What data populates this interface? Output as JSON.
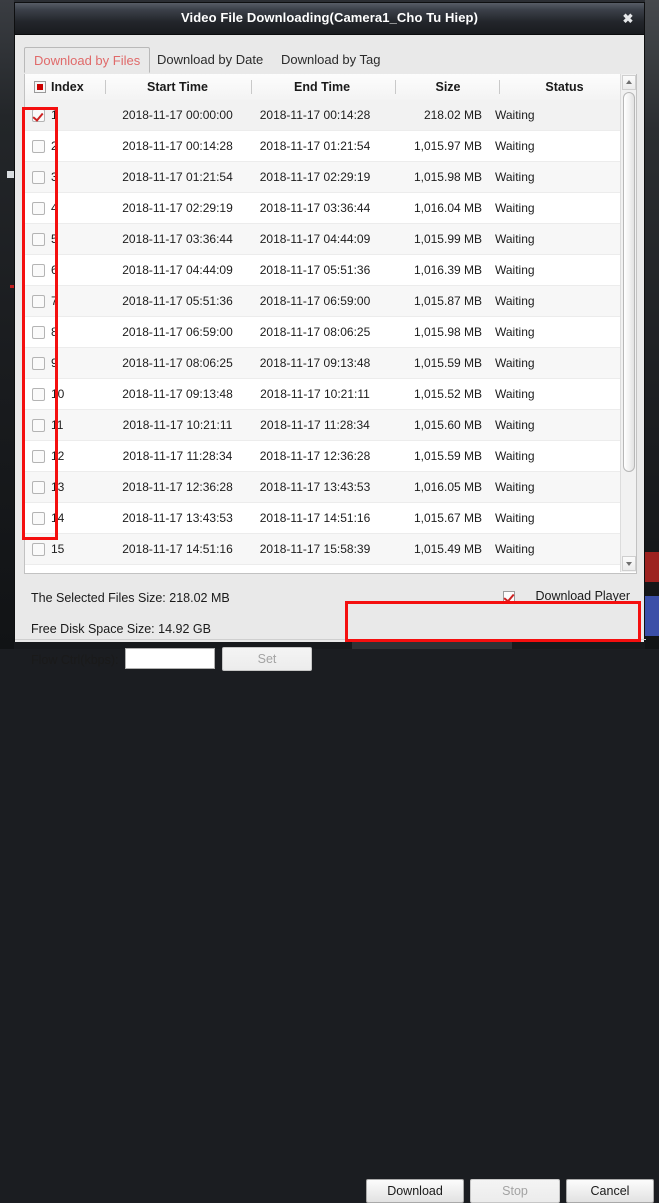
{
  "window": {
    "title": "Video File Downloading(Camera1_Cho Tu Hiep)",
    "close_label": "✖"
  },
  "tabs": [
    {
      "label": "Download by Files",
      "active": true
    },
    {
      "label": "Download by Date",
      "active": false
    },
    {
      "label": "Download by Tag",
      "active": false
    }
  ],
  "table": {
    "columns": [
      "Index",
      "Start Time",
      "End Time",
      "Size",
      "Status"
    ],
    "header_checkbox_state": "partial",
    "rows": [
      {
        "checked": true,
        "index": "1",
        "start": "2018-11-17 00:00:00",
        "end": "2018-11-17 00:14:28",
        "size": "218.02 MB",
        "status": "Waiting"
      },
      {
        "checked": false,
        "index": "2",
        "start": "2018-11-17 00:14:28",
        "end": "2018-11-17 01:21:54",
        "size": "1,015.97 MB",
        "status": "Waiting"
      },
      {
        "checked": false,
        "index": "3",
        "start": "2018-11-17 01:21:54",
        "end": "2018-11-17 02:29:19",
        "size": "1,015.98 MB",
        "status": "Waiting"
      },
      {
        "checked": false,
        "index": "4",
        "start": "2018-11-17 02:29:19",
        "end": "2018-11-17 03:36:44",
        "size": "1,016.04 MB",
        "status": "Waiting"
      },
      {
        "checked": false,
        "index": "5",
        "start": "2018-11-17 03:36:44",
        "end": "2018-11-17 04:44:09",
        "size": "1,015.99 MB",
        "status": "Waiting"
      },
      {
        "checked": false,
        "index": "6",
        "start": "2018-11-17 04:44:09",
        "end": "2018-11-17 05:51:36",
        "size": "1,016.39 MB",
        "status": "Waiting"
      },
      {
        "checked": false,
        "index": "7",
        "start": "2018-11-17 05:51:36",
        "end": "2018-11-17 06:59:00",
        "size": "1,015.87 MB",
        "status": "Waiting"
      },
      {
        "checked": false,
        "index": "8",
        "start": "2018-11-17 06:59:00",
        "end": "2018-11-17 08:06:25",
        "size": "1,015.98 MB",
        "status": "Waiting"
      },
      {
        "checked": false,
        "index": "9",
        "start": "2018-11-17 08:06:25",
        "end": "2018-11-17 09:13:48",
        "size": "1,015.59 MB",
        "status": "Waiting"
      },
      {
        "checked": false,
        "index": "10",
        "start": "2018-11-17 09:13:48",
        "end": "2018-11-17 10:21:11",
        "size": "1,015.52 MB",
        "status": "Waiting"
      },
      {
        "checked": false,
        "index": "11",
        "start": "2018-11-17 10:21:11",
        "end": "2018-11-17 11:28:34",
        "size": "1,015.60 MB",
        "status": "Waiting"
      },
      {
        "checked": false,
        "index": "12",
        "start": "2018-11-17 11:28:34",
        "end": "2018-11-17 12:36:28",
        "size": "1,015.59 MB",
        "status": "Waiting"
      },
      {
        "checked": false,
        "index": "13",
        "start": "2018-11-17 12:36:28",
        "end": "2018-11-17 13:43:53",
        "size": "1,016.05 MB",
        "status": "Waiting"
      },
      {
        "checked": false,
        "index": "14",
        "start": "2018-11-17 13:43:53",
        "end": "2018-11-17 14:51:16",
        "size": "1,015.67 MB",
        "status": "Waiting"
      },
      {
        "checked": false,
        "index": "15",
        "start": "2018-11-17 14:51:16",
        "end": "2018-11-17 15:58:39",
        "size": "1,015.49 MB",
        "status": "Waiting"
      }
    ]
  },
  "footer": {
    "selected_files_size": "The Selected Files Size:  218.02 MB",
    "free_disk_space": "Free Disk Space Size:  14.92 GB",
    "flow_ctrl_label": "Flow Ctrl(kbps):",
    "flow_ctrl_value": "",
    "flow_ctrl_placeholder": "",
    "download_player_label": "Download Player",
    "download_player_checked": true,
    "set_label": "Set",
    "set_enabled": false,
    "download_label": "Download",
    "download_enabled": true,
    "stop_label": "Stop",
    "stop_enabled": false,
    "cancel_label": "Cancel",
    "cancel_enabled": true
  },
  "annotations": {
    "color": "#f40f0f",
    "regions": [
      "checkbox-column",
      "action-buttons"
    ]
  },
  "backdrop": {
    "taskbar_item_label": ""
  }
}
